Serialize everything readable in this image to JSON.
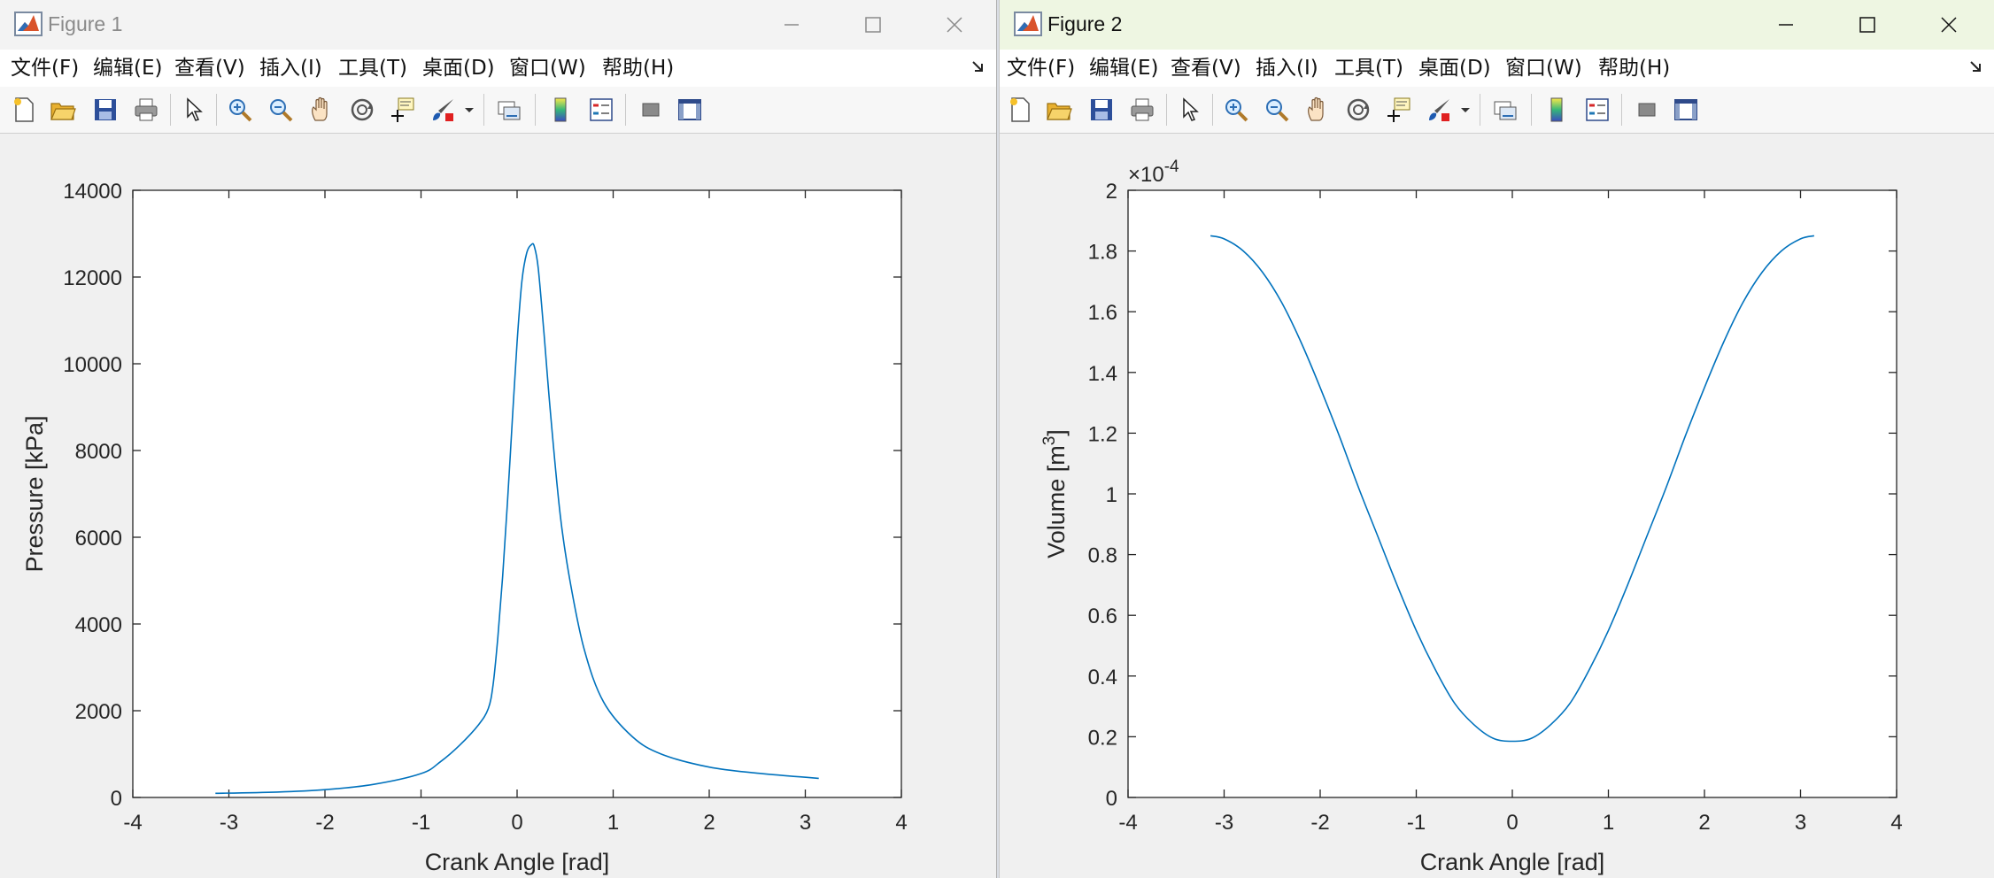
{
  "windows": [
    {
      "title": "Figure 1",
      "menu": [
        "文件(F)",
        "编辑(E)",
        "查看(V)",
        "插入(I)",
        "工具(T)",
        "桌面(D)",
        "窗口(W)",
        "帮助(H)"
      ]
    },
    {
      "title": "Figure 2",
      "menu": [
        "文件(F)",
        "编辑(E)",
        "查看(V)",
        "插入(I)",
        "工具(T)",
        "桌面(D)",
        "窗口(W)",
        "帮助(H)"
      ]
    }
  ],
  "colors": {
    "line": "#0072bd",
    "axis": "#262626",
    "figure_bg": "#f0f0f0"
  },
  "chart_data": [
    {
      "type": "line",
      "title": "",
      "xlabel": "Crank Angle [rad]",
      "ylabel": "Pressure [kPa]",
      "xlim": [
        -4,
        4
      ],
      "ylim": [
        0,
        14000
      ],
      "xticks": [
        "-4",
        "-3",
        "-2",
        "-1",
        "0",
        "1",
        "2",
        "3",
        "4"
      ],
      "yticks": [
        "0",
        "2000",
        "4000",
        "6000",
        "8000",
        "10000",
        "12000",
        "14000"
      ],
      "grid": false,
      "series": [
        {
          "x": [
            -3.14,
            -2.5,
            -2.0,
            -1.5,
            -1.0,
            -0.8,
            -0.6,
            -0.4,
            -0.3,
            -0.25,
            -0.2,
            -0.15,
            -0.1,
            -0.05,
            0.0,
            0.05,
            0.1,
            0.15,
            0.18,
            0.22,
            0.28,
            0.35,
            0.45,
            0.55,
            0.7,
            0.9,
            1.2,
            1.5,
            2.0,
            2.5,
            3.14
          ],
          "y": [
            95,
            125,
            180,
            300,
            550,
            820,
            1200,
            1680,
            2050,
            2600,
            3700,
            5100,
            6800,
            8700,
            10500,
            11900,
            12550,
            12750,
            12700,
            12200,
            10700,
            8800,
            6500,
            5000,
            3400,
            2200,
            1400,
            1000,
            700,
            560,
            440
          ]
        }
      ]
    },
    {
      "type": "line",
      "title": "",
      "xlabel": "Crank Angle [rad]",
      "ylabel": "Volume [m3]",
      "scale_label": "×10-4",
      "xlim": [
        -4,
        4
      ],
      "ylim": [
        0,
        2
      ],
      "xticks": [
        "-4",
        "-3",
        "-2",
        "-1",
        "0",
        "1",
        "2",
        "3",
        "4"
      ],
      "yticks": [
        "0",
        "0.2",
        "0.4",
        "0.6",
        "0.8",
        "1",
        "1.2",
        "1.4",
        "1.6",
        "1.8",
        "2"
      ],
      "grid": false,
      "series": [
        {
          "x": [
            -3.1416,
            -3.0,
            -2.8,
            -2.6,
            -2.4,
            -2.2,
            -2.0,
            -1.8,
            -1.6,
            -1.4,
            -1.2,
            -1.0,
            -0.8,
            -0.6,
            -0.4,
            -0.2,
            0.0,
            0.2,
            0.4,
            0.6,
            0.8,
            1.0,
            1.2,
            1.4,
            1.6,
            1.8,
            2.0,
            2.2,
            2.4,
            2.6,
            2.8,
            3.0,
            3.1416
          ],
          "y": [
            1.85,
            1.84,
            1.8,
            1.73,
            1.63,
            1.5,
            1.35,
            1.19,
            1.02,
            0.86,
            0.7,
            0.55,
            0.42,
            0.31,
            0.24,
            0.195,
            0.185,
            0.195,
            0.24,
            0.31,
            0.42,
            0.55,
            0.7,
            0.86,
            1.02,
            1.19,
            1.35,
            1.5,
            1.63,
            1.73,
            1.8,
            1.84,
            1.85
          ]
        }
      ]
    }
  ]
}
